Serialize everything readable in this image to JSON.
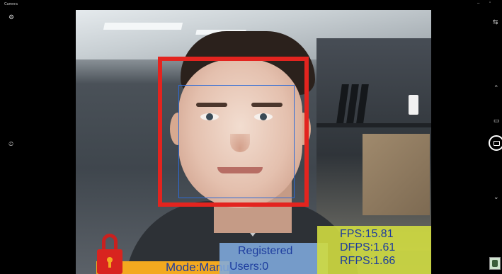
{
  "window": {
    "title": "Camera",
    "minimize_glyph": "–",
    "maximize_glyph": "▫"
  },
  "left_rail": [
    {
      "icon": "settings-icon",
      "glyph": "⚙"
    },
    {
      "icon": "timer-icon",
      "glyph": "⏲"
    }
  ],
  "right_rail": [
    {
      "icon": "switch-camera-icon",
      "glyph": "⇆"
    },
    {
      "icon": "chevron-up-icon",
      "glyph": "⌃"
    },
    {
      "icon": "video-mode-icon",
      "glyph": "▭"
    },
    {
      "icon": "chevron-down-icon",
      "glyph": "⌄"
    }
  ],
  "shutter": {
    "icon": "photo-capture-icon"
  },
  "overlay": {
    "mode_text": "Mode:Manual",
    "registered_label": "Registered",
    "users_text": "Users:0",
    "fps_text": "FPS:15.81",
    "dfps_text": "DFPS:1.61",
    "rfps_text": "RFPS:1.66",
    "lock_icon": "lock-icon"
  },
  "colors": {
    "detect_box": "#e3241f",
    "recog_box": "#2e6bd6",
    "mode_panel": "#f3a91f",
    "registered_panel": "#7faade",
    "fps_panel": "#d0dc40",
    "overlay_text": "#1d3c9e"
  }
}
